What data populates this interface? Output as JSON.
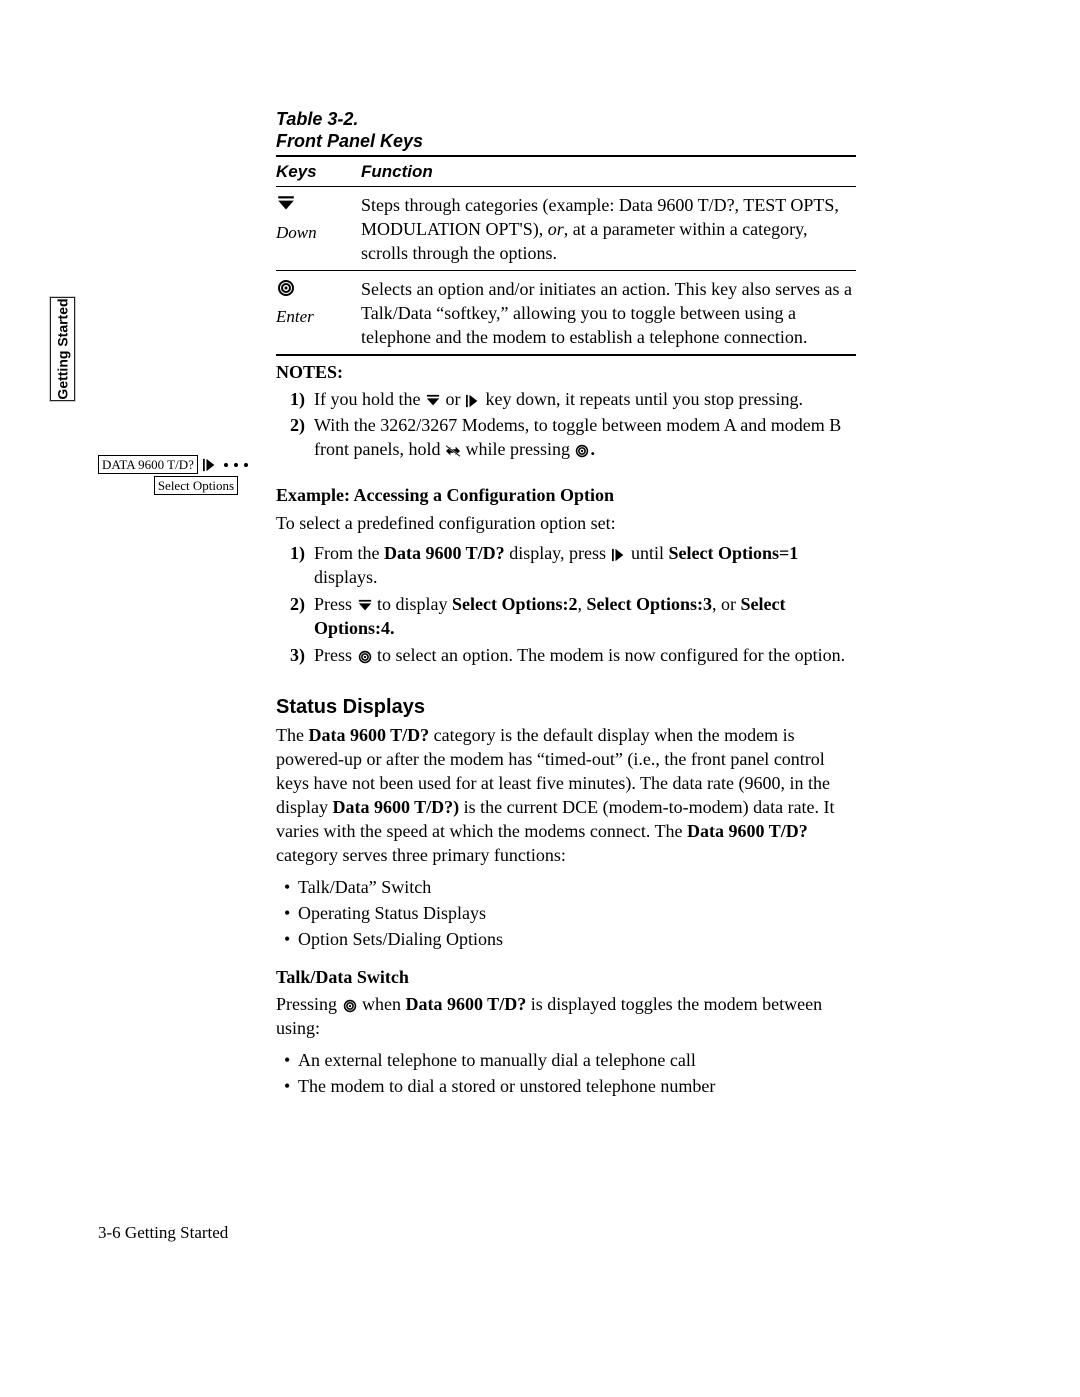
{
  "side_tab": {
    "label": "Getting Started"
  },
  "table": {
    "caption_line1": "Table 3-2.",
    "caption_line2": "Front Panel Keys",
    "head": {
      "keys": "Keys",
      "function": "Function"
    },
    "rows": [
      {
        "key_label": "Down",
        "func_a": "Steps through categories (example: Data 9600 T/D?, TEST OPTS, MODULATION OPT'S), ",
        "func_em": "or",
        "func_b": ", at a parameter within a category, scrolls through the options."
      },
      {
        "key_label": "Enter",
        "func_a": "Selects an option and/or initiates an action. This key also serves as a Talk/Data “softkey,” allowing you to toggle between using a telephone and the modem to establish a telephone connection.",
        "func_em": "",
        "func_b": ""
      }
    ]
  },
  "notes": {
    "label": "NOTES",
    "colon": ":",
    "items": [
      {
        "marker": "1)",
        "a": "If you hold the ",
        "b": " or ",
        "c": " key down, it repeats until you stop pressing."
      },
      {
        "marker": "2)",
        "a": "With the 3262/3267 Modems, to toggle between modem A and modem B front panels, hold ",
        "b": " while pressing ",
        "c": "."
      }
    ]
  },
  "example": {
    "heading": "Example: Accessing a Configuration Option",
    "intro": "To select a predefined configuration option set:",
    "steps": [
      {
        "marker": "1)",
        "a": "From the ",
        "b1": "Data 9600 T/D?",
        "c": " display, press ",
        "d": " until ",
        "b2": "Select Options=1",
        "e": " displays."
      },
      {
        "marker": "2)",
        "a": "Press ",
        "c": " to display ",
        "b1": "Select Options:2",
        "comma1": ", ",
        "b2": "Select Options:3",
        "comma2": ", or ",
        "b3": "Select Options:4."
      },
      {
        "marker": "3)",
        "a": "Press ",
        "c": " to select an option. The modem is now configured for the option."
      }
    ]
  },
  "margin_diagram": {
    "title": "DATA 9600 T/D?",
    "subtitle": "Select Options"
  },
  "status": {
    "heading": "Status Displays",
    "p1_a": "The ",
    "p1_b1": "Data 9600 T/D?",
    "p1_b": " category is the default display when the modem is powered-up or after the modem has “timed-out” (i.e., the front panel control keys have not been used for at least five minutes). The data rate (9600, in the display ",
    "p1_b2": "Data 9600 T/D?)",
    "p1_c": " is the current DCE (modem-to-modem) data rate. It varies with the speed at which the modems connect. The ",
    "p1_b3": "Data 9600 T/D?",
    "p1_d": " category serves three primary functions:",
    "bullets": [
      "Talk/Data” Switch",
      "Operating Status Displays",
      "Option Sets/Dialing Options"
    ],
    "sub_heading": "Talk/Data Switch",
    "p2_a": "Pressing ",
    "p2_b": " when ",
    "p2_b1": "Data 9600 T/D?",
    "p2_c": " is displayed toggles the modem between using:",
    "bullets2": [
      "An external telephone to manually dial a telephone call",
      "The modem to dial a stored or unstored telephone number"
    ]
  },
  "footer": "3-6 Getting Started"
}
